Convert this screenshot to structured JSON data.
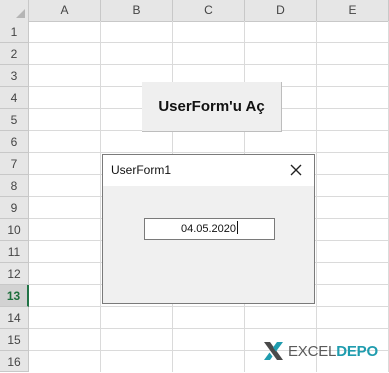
{
  "columns": [
    "A",
    "B",
    "C",
    "D",
    "E"
  ],
  "rows": [
    "1",
    "2",
    "3",
    "4",
    "5",
    "6",
    "7",
    "8",
    "9",
    "10",
    "11",
    "12",
    "13",
    "14",
    "15",
    "16"
  ],
  "active_row": "13",
  "sheet_button": {
    "label": "UserForm'u Aç"
  },
  "userform": {
    "title": "UserForm1",
    "textbox_value": "04.05.2020"
  },
  "logo": {
    "text_part1": "EXCEL",
    "text_part2": "DEPO"
  },
  "colors": {
    "accent_green": "#217346",
    "logo_teal": "#1f9cae"
  },
  "icons": {
    "close": "close-icon",
    "logo": "exceldepo-logo-icon"
  }
}
